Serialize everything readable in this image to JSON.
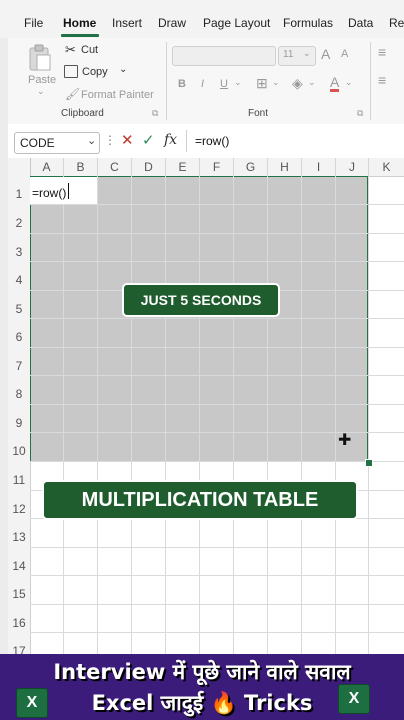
{
  "tabs": [
    "File",
    "Home",
    "Insert",
    "Draw",
    "Page Layout",
    "Formulas",
    "Data",
    "Re"
  ],
  "ribbon": {
    "paste": "Paste",
    "cut": "Cut",
    "copy": "Copy",
    "format_painter": "Format Painter",
    "clipboard_label": "Clipboard",
    "font_size": "11",
    "bold": "B",
    "italic": "I",
    "underline": "U",
    "font_label": "Font",
    "grow_font": "A",
    "shrink_font": "A",
    "font_color": "A"
  },
  "formula_bar": {
    "name_box": "CODE",
    "fx": "fx",
    "formula": "=row()"
  },
  "columns": [
    "A",
    "B",
    "C",
    "D",
    "E",
    "F",
    "G",
    "H",
    "I",
    "J",
    "K"
  ],
  "rows": [
    "1",
    "2",
    "3",
    "4",
    "5",
    "6",
    "7",
    "8",
    "9",
    "10",
    "11",
    "12",
    "13",
    "14",
    "15",
    "16",
    "17"
  ],
  "cells": {
    "A1": "=row()"
  },
  "overlays": {
    "seconds_badge": "JUST 5 SECONDS",
    "title_badge": "MULTIPLICATION TABLE"
  },
  "banner": {
    "line1": "Interview में पूछे जाने वाले सवाल",
    "line2": "Excel जादुई 🔥 Tricks",
    "excel_logo": "X"
  },
  "colors": {
    "accent": "#1e7145",
    "badge": "#1f5c2e",
    "banner": "#3b1c7a",
    "selection": "#c8c8c8"
  }
}
